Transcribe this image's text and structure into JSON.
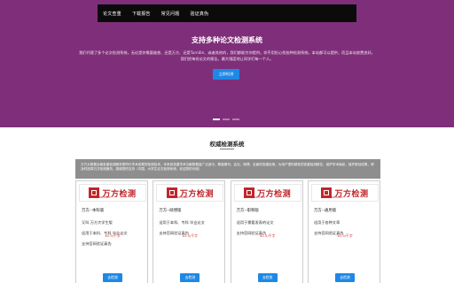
{
  "nav": {
    "items": [
      "论文查重",
      "下载报告",
      "常见问题",
      "验证真伪"
    ]
  },
  "hero": {
    "title": "支持多种论文检测系统",
    "desc_line1": "我们代理了多个论文检测系统，无论是你需要维普、还是万方、还是Turnitin、或者其他的，我们都能为你提供。你不用担心找各种检测系统，本站都可以提供，而且本站收费良好。",
    "desc_line2": "我们把每份论文的报告，最大限度地让同学们每一个人。",
    "button": "立即检测"
  },
  "section": {
    "title": "权威检测系统",
    "notice": "万方大数据合格查重检测服务是同行学术成果的检测技术，本系统查重学术文献数据量广泛适中，覆盖期刊、会议、硕博、全面的查重检测。为用户提供精准的查重检测报告，维护学术版权，保护原创成果，请及时选择万方检测服务，感谢您的支持（中国，大学生论文检测系统，欢迎您的光临）"
  },
  "cards": [
    {
      "logo": "万方检测",
      "logo_sub": "万方数据 检测服务",
      "name": "万方--本科版",
      "lines": [
        "又叫 万方大学生版",
        "适用于本科、专科 毕业论文",
        "支持官网验证真伪"
      ],
      "price": "¥2.5/千字",
      "button": "去检测"
    },
    {
      "logo": "万方检测",
      "logo_sub": "万方数据 检测服务",
      "name": "万方--硕博版",
      "lines": [
        "适用于本科、专科 毕业论文",
        "支持官网验证真伪"
      ],
      "price": "¥2.5/千字",
      "button": "去检测"
    },
    {
      "logo": "万方检测",
      "logo_sub": "万方数据 检测服务",
      "name": "万方--职称版",
      "lines": [
        "适用于需要发表的论文",
        "支持官网验证真伪"
      ],
      "price": "¥2.5/千字",
      "button": "去检测"
    },
    {
      "logo": "万方检测",
      "logo_sub": "万方数据 检测服务",
      "name": "万方--通用版",
      "lines": [
        "适用于各种文章",
        "支持官网验证真伪"
      ],
      "price": "¥2.5/千字",
      "button": "去检测"
    }
  ]
}
